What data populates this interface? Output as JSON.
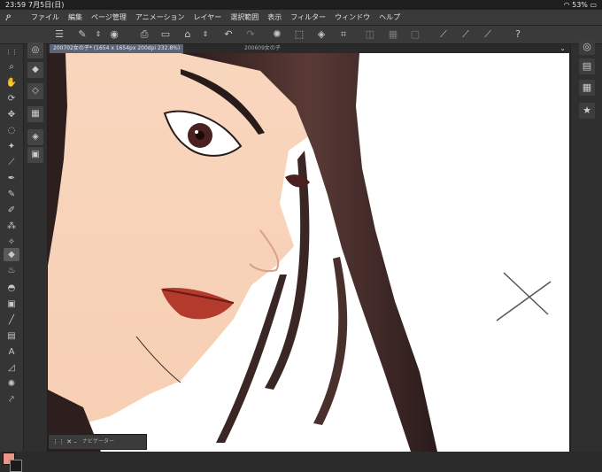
{
  "status": {
    "time": "23:59",
    "date": "7月5日(日)",
    "battery": "53%"
  },
  "menu": [
    "ファイル",
    "編集",
    "ページ管理",
    "アニメーション",
    "レイヤー",
    "選択範囲",
    "表示",
    "フィルター",
    "ウィンドウ",
    "ヘルプ"
  ],
  "tabs": {
    "active": "20070​2女の子* (1654 x 1654px 200dpi 232.8%)",
    "inactive": "200609女の子"
  },
  "navigator": {
    "label": "ナビゲーター"
  },
  "colors": {
    "foreground": "#e8968a",
    "background": "#1a1a1a",
    "accent": "#5c6478"
  },
  "icons": {
    "toolbar": [
      "menu-icon",
      "new-file-icon",
      "save-icon",
      "open-file-icon",
      "print-icon",
      "undo-icon",
      "redo-icon",
      "loading-icon",
      "fill-icon",
      "transform-icon",
      "ruler-icon",
      "brush-settings-icon",
      "help-icon"
    ],
    "left_tools": [
      "zoom-icon",
      "hand-icon",
      "rotate-icon",
      "move-icon",
      "lasso-icon",
      "magic-wand-icon",
      "eyedropper-icon",
      "pen-icon",
      "pencil-icon",
      "brush-icon",
      "airbrush-icon",
      "decoration-icon",
      "eraser-icon",
      "blend-icon",
      "fill-icon",
      "gradient-icon",
      "figure-icon",
      "frame-icon",
      "text-icon",
      "balloon-icon",
      "correct-line-icon"
    ]
  }
}
